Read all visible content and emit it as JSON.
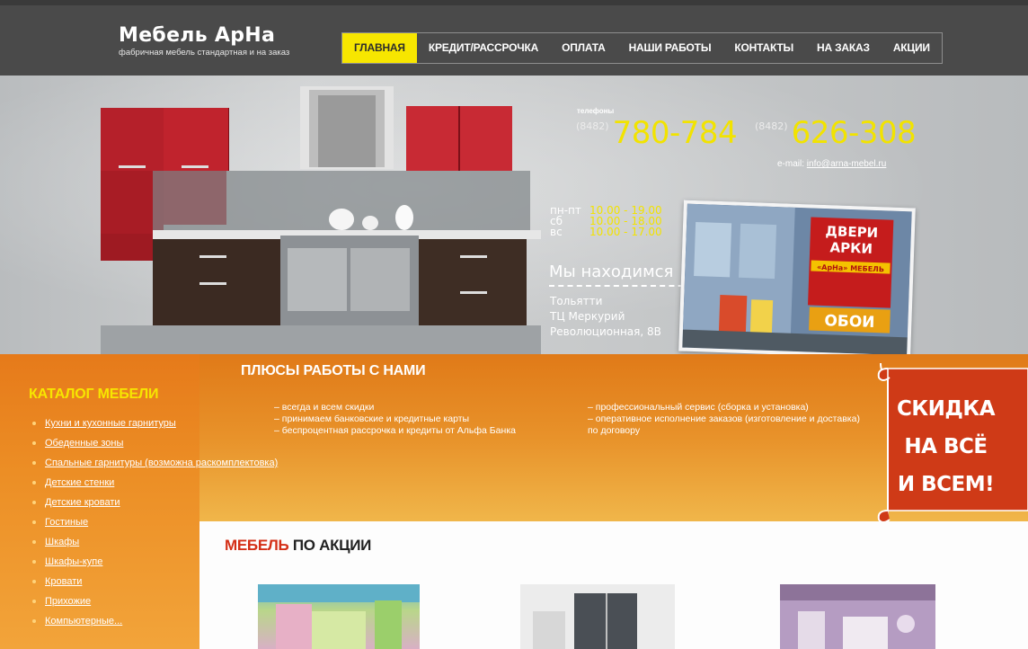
{
  "brand": {
    "title": "Мебель АрНа",
    "subtitle": "фабричная мебель стандартная и на заказ"
  },
  "nav": {
    "items": [
      {
        "label": "ГЛАВНАЯ",
        "active": true
      },
      {
        "label": "КРЕДИТ/РАССРОЧКА",
        "active": false
      },
      {
        "label": "ОПЛАТА",
        "active": false
      },
      {
        "label": "НАШИ РАБОТЫ",
        "active": false
      },
      {
        "label": "КОНТАКТЫ",
        "active": false
      },
      {
        "label": "НА ЗАКАЗ",
        "active": false
      },
      {
        "label": "АКЦИИ",
        "active": false
      }
    ]
  },
  "contacts": {
    "phones_label": "телефоны",
    "phone1_code": "(8482)",
    "phone1": "780-784",
    "phone2_code": "(8482)",
    "phone2": "626-308",
    "email_label": "e-mail:",
    "email": "info@arna-mebel.ru"
  },
  "hours": [
    {
      "day": "пн-пт",
      "time": "10.00 - 19.00"
    },
    {
      "day": "сб",
      "time": "10.00 - 18.00"
    },
    {
      "day": "вс",
      "time": "10.00 - 17.00"
    }
  ],
  "location": {
    "title": "Мы находимся",
    "city": "Тольятти",
    "mall": "ТЦ Меркурий",
    "street": "Революционная, 8В"
  },
  "photo_sign": {
    "line1": "ДВЕРИ",
    "line2": "АРКИ",
    "line3": "«АрНа» МЕБЕЛЬ",
    "line4": "ОБОИ"
  },
  "catalog": {
    "title": "КАТАЛОГ МЕБЕЛИ",
    "items": [
      "Кухни и кухонные гарнитуры",
      "Обеденные зоны",
      "Спальные гарнитуры (возможна раскомплектовка)",
      "Детские стенки",
      "Детские кровати",
      "Гостиные",
      "Шкафы",
      "Шкафы-купе",
      "Кровати",
      "Прихожие",
      "Компьютерные..."
    ]
  },
  "benefits": {
    "title": "ПЛЮСЫ РАБОТЫ С НАМИ",
    "col1": [
      "– всегда и всем скидки",
      "– принимаем банковские и кредитные карты",
      "– беспроцентная рассрочка и кредиты от Альфа Банка"
    ],
    "col2": [
      "– профессиональный сервис (сборка и установка)",
      "– оперативное исполнение заказов (изготовление и доставка) по договору"
    ]
  },
  "promo": {
    "line1": "СКИДКА",
    "line2": "НА ВСЁ",
    "line3": "И ВСЕМ!"
  },
  "section": {
    "title_red": "МЕБЕЛЬ",
    "title_dark": " ПО АКЦИИ"
  },
  "colors": {
    "header_bg": "#4a4a4a",
    "accent_yellow": "#f7e600",
    "orange": "#e8922a",
    "promo_red": "#cf3a17",
    "title_red": "#d42f16"
  }
}
